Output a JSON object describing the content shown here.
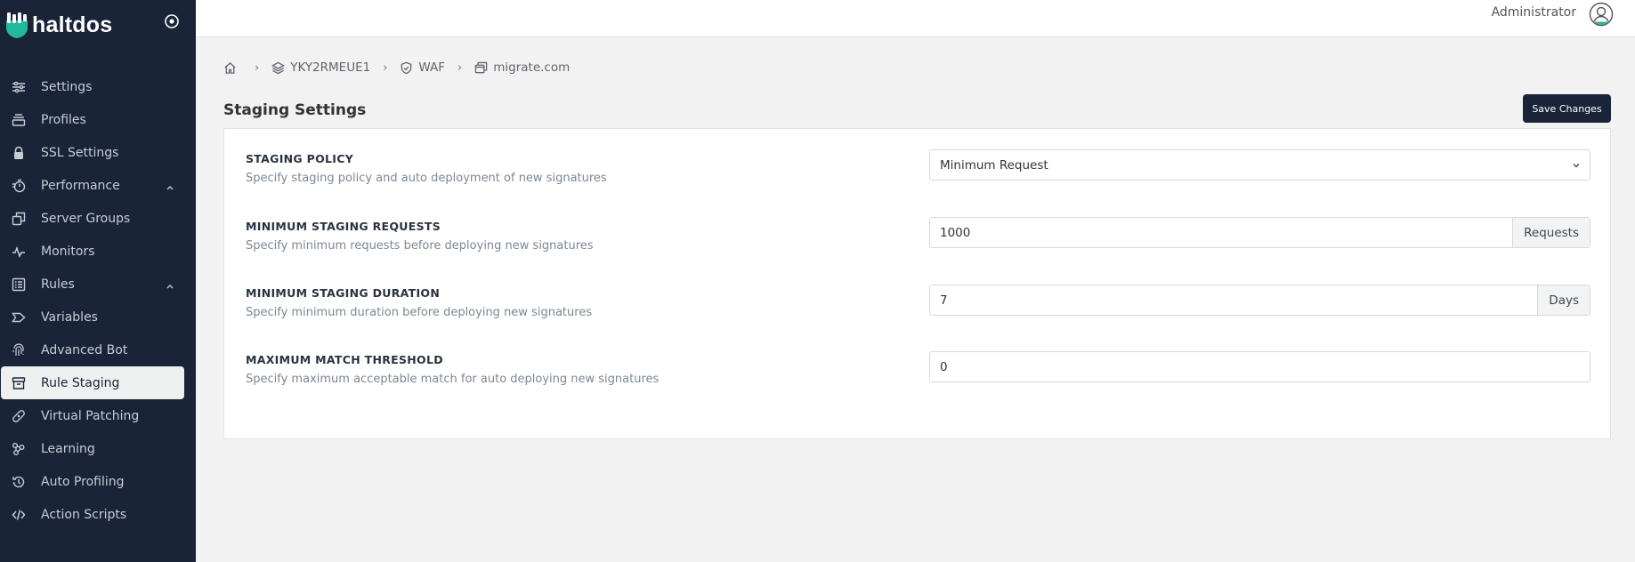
{
  "brand": {
    "name": "haltdos"
  },
  "sidebar": {
    "items": [
      {
        "label": "Settings",
        "icon": "sliders-icon",
        "expandable": false,
        "active": false
      },
      {
        "label": "Profiles",
        "icon": "stack-icon",
        "expandable": false,
        "active": false
      },
      {
        "label": "SSL Settings",
        "icon": "lock-icon",
        "expandable": false,
        "active": false
      },
      {
        "label": "Performance",
        "icon": "stopwatch-icon",
        "expandable": true,
        "active": false
      },
      {
        "label": "Server Groups",
        "icon": "copy-icon",
        "expandable": false,
        "active": false
      },
      {
        "label": "Monitors",
        "icon": "pulse-icon",
        "expandable": false,
        "active": false
      },
      {
        "label": "Rules",
        "icon": "list-icon",
        "expandable": true,
        "active": false
      },
      {
        "label": "Variables",
        "icon": "tag-icon",
        "expandable": false,
        "active": false
      },
      {
        "label": "Advanced Bot",
        "icon": "fingerprint-icon",
        "expandable": false,
        "active": false
      },
      {
        "label": "Rule Staging",
        "icon": "archive-icon",
        "expandable": false,
        "active": true
      },
      {
        "label": "Virtual Patching",
        "icon": "bandage-icon",
        "expandable": false,
        "active": false
      },
      {
        "label": "Learning",
        "icon": "network-icon",
        "expandable": false,
        "active": false
      },
      {
        "label": "Auto Profiling",
        "icon": "history-icon",
        "expandable": false,
        "active": false
      },
      {
        "label": "Action Scripts",
        "icon": "code-icon",
        "expandable": false,
        "active": false
      }
    ]
  },
  "header": {
    "user": "Administrator"
  },
  "breadcrumb": [
    "YKY2RMEUE1",
    "WAF",
    "migrate.com"
  ],
  "page": {
    "title": "Staging Settings",
    "save_label": "Save Changes"
  },
  "form": {
    "staging_policy": {
      "label": "STAGING POLICY",
      "help": "Specify staging policy and auto deployment of new signatures",
      "value": "Minimum Request"
    },
    "min_requests": {
      "label": "MINIMUM STAGING REQUESTS",
      "help": "Specify minimum requests before deploying new signatures",
      "value": "1000",
      "unit": "Requests"
    },
    "min_duration": {
      "label": "MINIMUM STAGING DURATION",
      "help": "Specify minimum duration before deploying new signatures",
      "value": "7",
      "unit": "Days"
    },
    "max_threshold": {
      "label": "MAXIMUM MATCH THRESHOLD",
      "help": "Specify maximum acceptable match for auto deploying new signatures",
      "value": "0"
    }
  },
  "colors": {
    "sidebar_bg": "#1a2438",
    "brand_accent": "#22b8a0",
    "page_bg": "#f1f2f1"
  }
}
